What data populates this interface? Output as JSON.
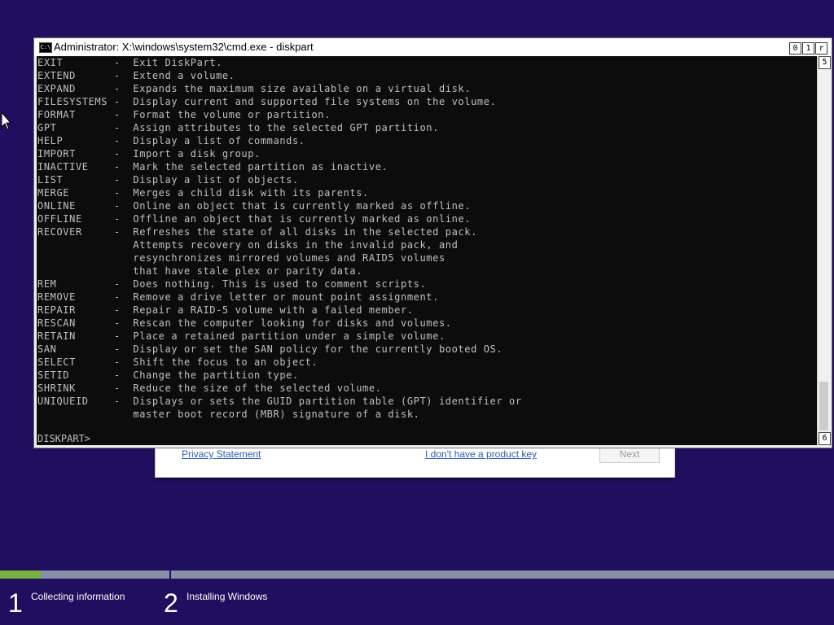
{
  "setup_dialog": {
    "privacy_label": "Privacy Statement",
    "no_key_label": "I don't have a product key",
    "next_label": "Next"
  },
  "cmd": {
    "title": "Administrator: X:\\windows\\system32\\cmd.exe - diskpart",
    "icon_text": "C:\\",
    "minimize_glyph": "0",
    "maximize_glyph": "1",
    "close_glyph": "r",
    "scroll_up_glyph": "5",
    "scroll_down_glyph": "6",
    "lines": [
      "EXIT        -  Exit DiskPart.",
      "EXTEND      -  Extend a volume.",
      "EXPAND      -  Expands the maximum size available on a virtual disk.",
      "FILESYSTEMS -  Display current and supported file systems on the volume.",
      "FORMAT      -  Format the volume or partition.",
      "GPT         -  Assign attributes to the selected GPT partition.",
      "HELP        -  Display a list of commands.",
      "IMPORT      -  Import a disk group.",
      "INACTIVE    -  Mark the selected partition as inactive.",
      "LIST        -  Display a list of objects.",
      "MERGE       -  Merges a child disk with its parents.",
      "ONLINE      -  Online an object that is currently marked as offline.",
      "OFFLINE     -  Offline an object that is currently marked as online.",
      "RECOVER     -  Refreshes the state of all disks in the selected pack.",
      "               Attempts recovery on disks in the invalid pack, and",
      "               resynchronizes mirrored volumes and RAID5 volumes",
      "               that have stale plex or parity data.",
      "REM         -  Does nothing. This is used to comment scripts.",
      "REMOVE      -  Remove a drive letter or mount point assignment.",
      "REPAIR      -  Repair a RAID-5 volume with a failed member.",
      "RESCAN      -  Rescan the computer looking for disks and volumes.",
      "RETAIN      -  Place a retained partition under a simple volume.",
      "SAN         -  Display or set the SAN policy for the currently booted OS.",
      "SELECT      -  Shift the focus to an object.",
      "SETID       -  Change the partition type.",
      "SHRINK      -  Reduce the size of the selected volume.",
      "UNIQUEID    -  Displays or sets the GUID partition table (GPT) identifier or",
      "               master boot record (MBR) signature of a disk."
    ],
    "prompt": "DISKPART>"
  },
  "progress": {
    "steps": [
      {
        "number": "1",
        "label": "Collecting information",
        "progress": 0.24
      },
      {
        "number": "2",
        "label": "Installing Windows",
        "progress": 0
      }
    ]
  },
  "colors": {
    "background": "#1f0f5e",
    "console_bg": "#0c0c0c",
    "console_text": "#c0c0c0",
    "progress_fill": "#7ab040",
    "progress_track": "#8a8fa8"
  }
}
